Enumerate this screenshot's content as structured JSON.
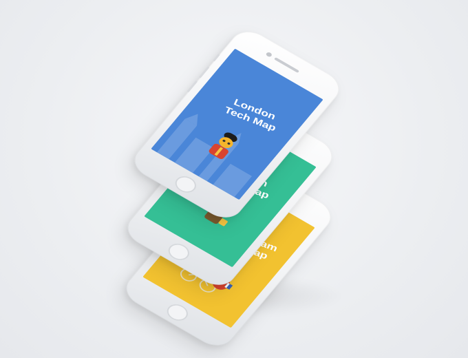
{
  "scene": {
    "background": "#eef0f2"
  },
  "phones": [
    {
      "id": "london",
      "screen_color": "#4a86d8",
      "title_line1": "London",
      "title_line2": "Tech Map",
      "mascot": "guard-bear-mascot-icon"
    },
    {
      "id": "munich",
      "screen_color": "#35bf95",
      "title_line1": "Munich",
      "title_line2": "Tech Map",
      "mascot": "bavarian-bear-mascot-icon"
    },
    {
      "id": "amsterdam",
      "screen_color": "#f2c230",
      "title_line1": "Amsterdam",
      "title_line2": "Tech Map",
      "mascot": "bicycle-bear-mascot-icon"
    }
  ]
}
